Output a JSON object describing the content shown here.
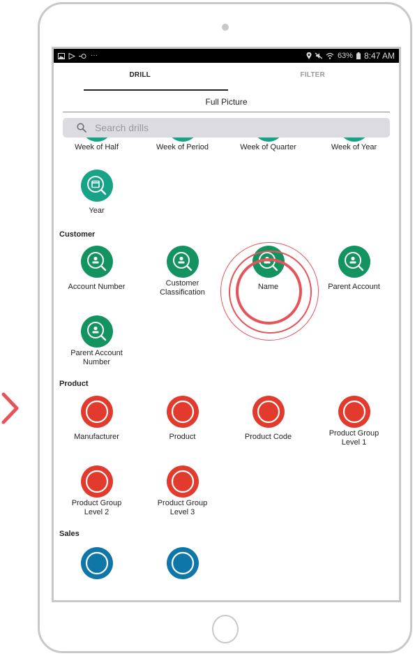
{
  "colors": {
    "time_green": "#17a388",
    "customer_green": "#12935f",
    "product_red": "#e23b2e",
    "sales_blue": "#0f77a8",
    "highlight": "#e5545a",
    "frame": "#c8c8c8"
  },
  "status_bar": {
    "left_icons": [
      "image-icon",
      "play-icon",
      "cast-icon",
      "more-icon"
    ],
    "more": "···",
    "right_icons": [
      "location-icon",
      "mute-icon",
      "wifi-icon",
      "battery-icon"
    ],
    "battery": "63%",
    "time": "8:47 AM"
  },
  "tabs": [
    {
      "label": "DRILL",
      "active": true
    },
    {
      "label": "FILTER",
      "active": false
    }
  ],
  "subtitle": "Full Picture",
  "search": {
    "placeholder": "Search drills",
    "value": ""
  },
  "time_items_partial": [
    {
      "label": "Week of Half"
    },
    {
      "label": "Week of Period"
    },
    {
      "label": "Week of Quarter"
    },
    {
      "label": "Week of Year"
    }
  ],
  "time_items": [
    {
      "label": "Year",
      "icon": "calendar-search-icon"
    }
  ],
  "sections": {
    "customer": {
      "title": "Customer",
      "items": [
        {
          "label": "Account Number"
        },
        {
          "label": "Customer Classification"
        },
        {
          "label": "Name",
          "highlighted": true
        },
        {
          "label": "Parent Account"
        },
        {
          "label": "Parent Account Number"
        }
      ]
    },
    "product": {
      "title": "Product",
      "items": [
        {
          "label": "Manufacturer"
        },
        {
          "label": "Product"
        },
        {
          "label": "Product Code"
        },
        {
          "label": "Product Group Level 1"
        },
        {
          "label": "Product Group Level 2"
        },
        {
          "label": "Product Group Level 3"
        }
      ]
    },
    "sales": {
      "title": "Sales",
      "items": [
        {
          "label": ""
        },
        {
          "label": ""
        }
      ]
    }
  }
}
